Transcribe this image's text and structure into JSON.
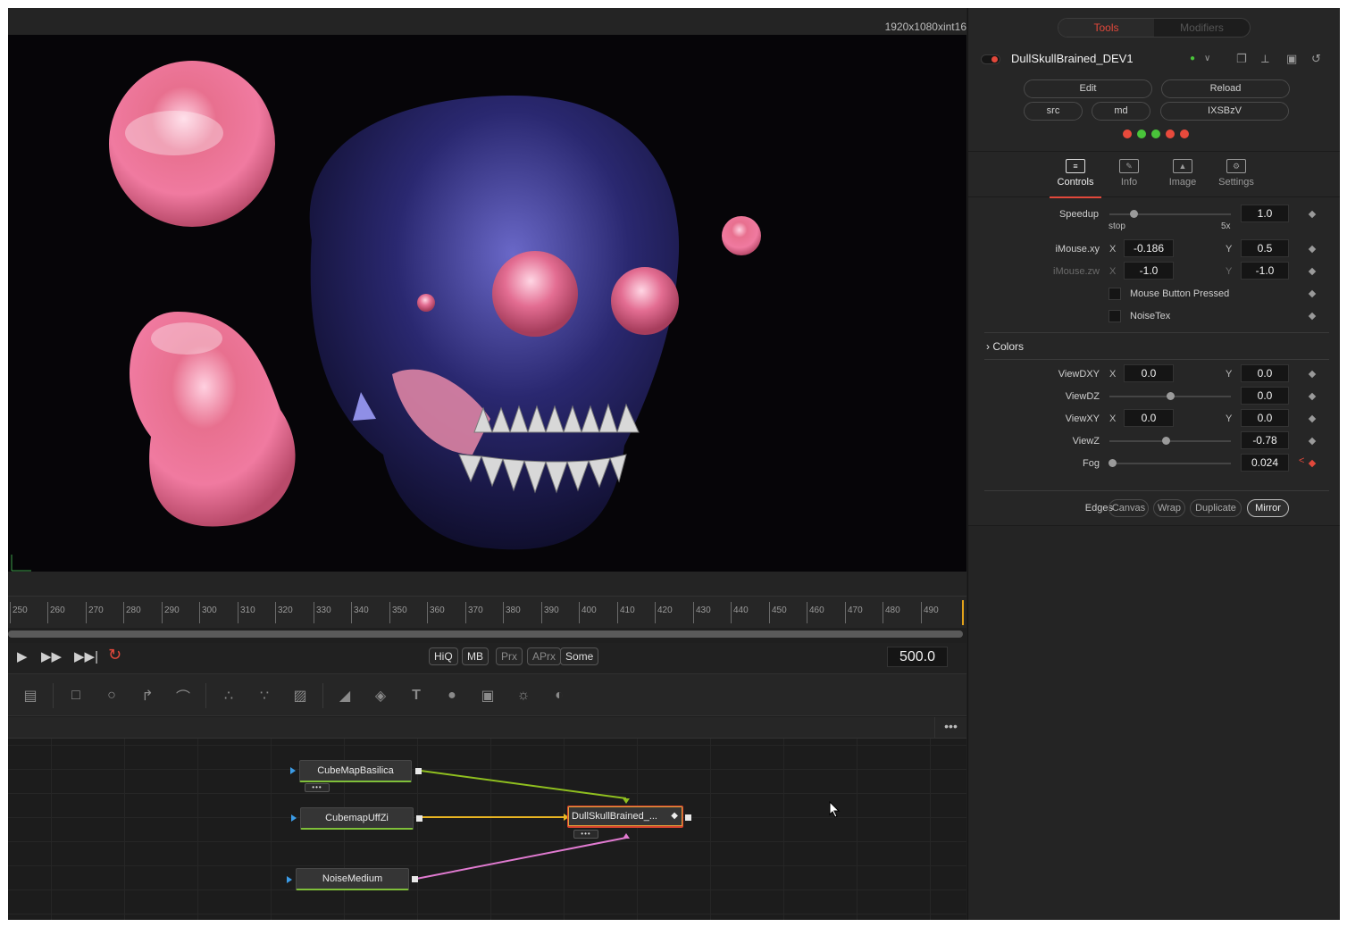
{
  "viewer": {
    "resolution": "1920x1080xint16"
  },
  "timeline": {
    "ticks": [
      "250",
      "260",
      "270",
      "280",
      "290",
      "300",
      "310",
      "320",
      "330",
      "340",
      "350",
      "360",
      "370",
      "380",
      "390",
      "400",
      "410",
      "420",
      "430",
      "440",
      "450",
      "460",
      "470",
      "480",
      "490"
    ],
    "current_frame": "500.0"
  },
  "transport": {
    "quality_buttons": [
      "HiQ",
      "MB",
      "Prx",
      "APrx",
      "Some"
    ]
  },
  "toolbar": {
    "icons": [
      "background-icon",
      "rectangle-icon",
      "ellipse-icon",
      "polygon-icon",
      "bspline-icon",
      "particle-emitter-icon",
      "particle-render-icon",
      "particle-merge-icon",
      "shape3d-icon",
      "merge3d-icon",
      "text3d-icon",
      "renderer3d-icon",
      "camera3d-icon",
      "light3d-icon",
      "imageplane3d-icon"
    ]
  },
  "node_editor": {
    "menu": "•••",
    "nodes": [
      {
        "name": "CubeMapBasilica"
      },
      {
        "name": "CubemapUffZi"
      },
      {
        "name": "NoiseMedium"
      },
      {
        "name": "DullSkullBrained_..."
      }
    ],
    "node_dots": "•••"
  },
  "inspector": {
    "tabs": [
      "Tools",
      "Modifiers"
    ],
    "active_tab": "Tools",
    "tool_name": "DullSkullBrained_DEV1",
    "buttons_row1": [
      "Edit",
      "Reload"
    ],
    "buttons_row2": [
      "src",
      "md",
      "IXSBzV"
    ],
    "status_colors": [
      "#e84a3c",
      "#49c43a",
      "#49c43a",
      "#e84a3c",
      "#e84a3c"
    ],
    "sub_tabs": [
      "Controls",
      "Info",
      "Image",
      "Settings"
    ],
    "active_sub_tab": "Controls",
    "speedup": {
      "label": "Speedup",
      "value": "1.0",
      "min_label": "stop",
      "max_label": "5x",
      "level": 0.2
    },
    "imouse_xy": {
      "label": "iMouse.xy",
      "x_label": "X",
      "x": "-0.186",
      "y_label": "Y",
      "y": "0.5"
    },
    "imouse_zw": {
      "label": "iMouse.zw",
      "x_label": "X",
      "x": "-1.0",
      "y_label": "Y",
      "y": "-1.0"
    },
    "mouse_button_pressed": "Mouse Button Pressed",
    "noise_tex": "NoiseTex",
    "colors_section": "Colors",
    "view_dxy": {
      "label": "ViewDXY",
      "x_label": "X",
      "x": "0.0",
      "y_label": "Y",
      "y": "0.0"
    },
    "view_dz": {
      "label": "ViewDZ",
      "value": "0.0",
      "level": 0.5
    },
    "view_xy": {
      "label": "ViewXY",
      "x_label": "X",
      "x": "0.0",
      "y_label": "Y",
      "y": "0.0"
    },
    "view_z": {
      "label": "ViewZ",
      "value": "-0.78",
      "level": 0.46
    },
    "fog": {
      "label": "Fog",
      "value": "0.024",
      "level": 0.02
    },
    "edges": {
      "label": "Edges",
      "options": [
        "Canvas",
        "Wrap",
        "Duplicate",
        "Mirror"
      ],
      "selected": "Mirror"
    }
  }
}
